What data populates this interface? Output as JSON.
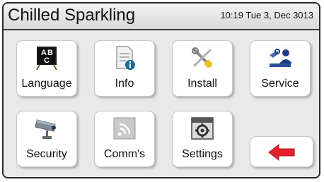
{
  "header": {
    "title": "Chilled Sparkling",
    "datetime": "10:19 Tue 3, Dec 3013"
  },
  "menu": {
    "language": {
      "label": "Language",
      "icon": "language-abc-icon"
    },
    "info": {
      "label": "Info",
      "icon": "info-document-icon"
    },
    "install": {
      "label": "Install",
      "icon": "install-tools-icon"
    },
    "service": {
      "label": "Service",
      "icon": "service-technician-icon"
    },
    "security": {
      "label": "Security",
      "icon": "security-camera-icon"
    },
    "comms": {
      "label": "Comm's",
      "icon": "comms-signal-icon"
    },
    "settings": {
      "label": "Settings",
      "icon": "settings-gear-icon"
    },
    "back": {
      "icon": "back-arrow-icon",
      "color": "#e4202c"
    }
  }
}
